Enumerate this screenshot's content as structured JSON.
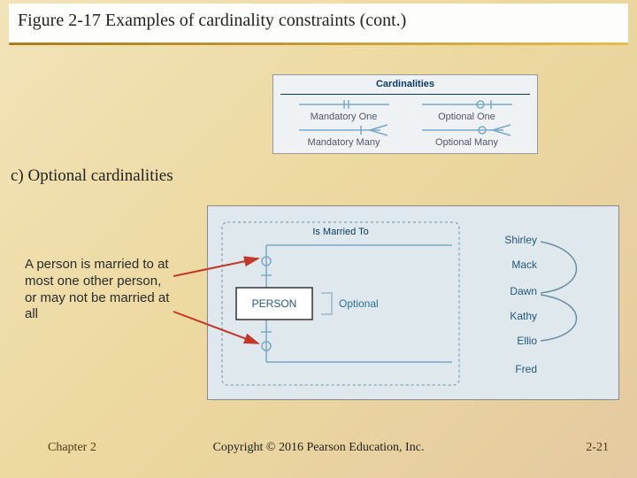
{
  "title": "Figure 2-17 Examples of cardinality constraints (cont.)",
  "legend": {
    "title": "Cardinalities",
    "items": [
      {
        "label": "Mandatory One"
      },
      {
        "label": "Optional One"
      },
      {
        "label": "Mandatory Many"
      },
      {
        "label": "Optional Many"
      }
    ]
  },
  "subtitle": "c) Optional cardinalities",
  "explanation": "A person is married to at most one other person, or may not be married at all",
  "diagram": {
    "relationship": "Is Married To",
    "entity": "PERSON",
    "tag": "Optional",
    "names": [
      "Shirley",
      "Mack",
      "Dawn",
      "Kathy",
      "Ellio",
      "Fred"
    ]
  },
  "footer": {
    "chapter": "Chapter 2",
    "copyright": "Copyright © 2016 Pearson Education, Inc.",
    "page": "2-21"
  }
}
